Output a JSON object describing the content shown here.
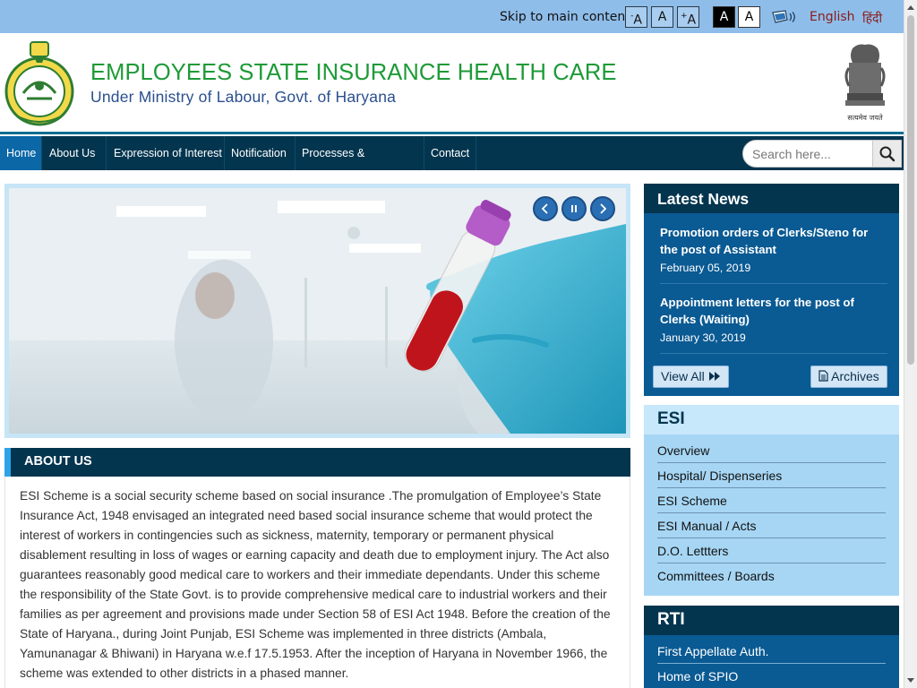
{
  "topbar": {
    "skip_label": "Skip to main content",
    "font_decrease": "A",
    "font_normal": "A",
    "font_increase": "A",
    "font_decrease_sign": "-",
    "font_increase_sign": "+",
    "contrast_dark": "A",
    "contrast_light": "A",
    "screen_reader_icon": "screen-reader-icon",
    "lang_english": "English",
    "lang_hindi": "हिंदी"
  },
  "header": {
    "title": "EMPLOYEES STATE INSURANCE HEALTH CARE",
    "subtitle": "Under Ministry of Labour, Govt. of Haryana",
    "emblem_caption": "सत्यमेव जयते",
    "left_logo": "haryana-govt-seal",
    "right_logo": "national-emblem"
  },
  "nav": {
    "items": [
      {
        "label": "Home",
        "active": true
      },
      {
        "label": "About Us",
        "active": false
      },
      {
        "label": "Expression of Interest",
        "active": false
      },
      {
        "label": "Notification",
        "active": false
      },
      {
        "label": "Processes & Procedures",
        "active": false
      },
      {
        "label": "Contact",
        "active": false
      }
    ],
    "search_placeholder": "Search here...",
    "search_icon": "search-icon"
  },
  "slider": {
    "controls": [
      "chevron-left-icon",
      "pause-icon",
      "chevron-right-icon"
    ]
  },
  "about": {
    "heading": "ABOUT US",
    "text": "ESI Scheme is a social security scheme based on social insurance .The promulgation of Employee’s State Insurance Act, 1948 envisaged an integrated need based social insurance scheme that would protect the interest of workers in contingencies such as sickness, maternity, temporary or permanent physical disablement resulting in loss of wages or earning capacity and death due to employment injury. The Act also guarantees reasonably good medical care to workers and their immediate dependants. Under this scheme the responsibility of the State Govt. is to provide comprehensive medical care to industrial workers and their families as per agreement and provisions made under Section 58 of ESI Act 1948. Before the creation of the State of Haryana., during Joint Punjab, ESI Scheme was implemented in three districts (Ambala, Yamunanagar & Bhiwani) in Haryana w.e.f 17.5.1953. After the inception of Haryana in November 1966, the scheme was extended to other districts in a phased manner."
  },
  "news": {
    "heading": "Latest News",
    "items": [
      {
        "title": "Promotion orders of Clerks/Steno for the post of Assistant",
        "date": "February 05, 2019"
      },
      {
        "title": "Appointment letters for the post of Clerks (Waiting)",
        "date": "January 30, 2019"
      }
    ],
    "view_all": "View All",
    "archives": "Archives"
  },
  "esi": {
    "heading": "ESI",
    "links": [
      "Overview",
      "Hospital/ Dispenseries",
      "ESI Scheme",
      "ESI Manual / Acts",
      "D.O. Lettters",
      "Committees / Boards"
    ]
  },
  "rti": {
    "heading": "RTI",
    "links": [
      "First Appellate Auth.",
      "Home of SPIO"
    ]
  },
  "colors": {
    "topbar": "#8fbde9",
    "nav": "#03354f",
    "nav_active": "#0b67a6",
    "title_green": "#1e9a37",
    "subtitle_blue": "#2a4f8f",
    "news_bg": "#0a5a93",
    "esi_bg": "#a6d6f4"
  }
}
